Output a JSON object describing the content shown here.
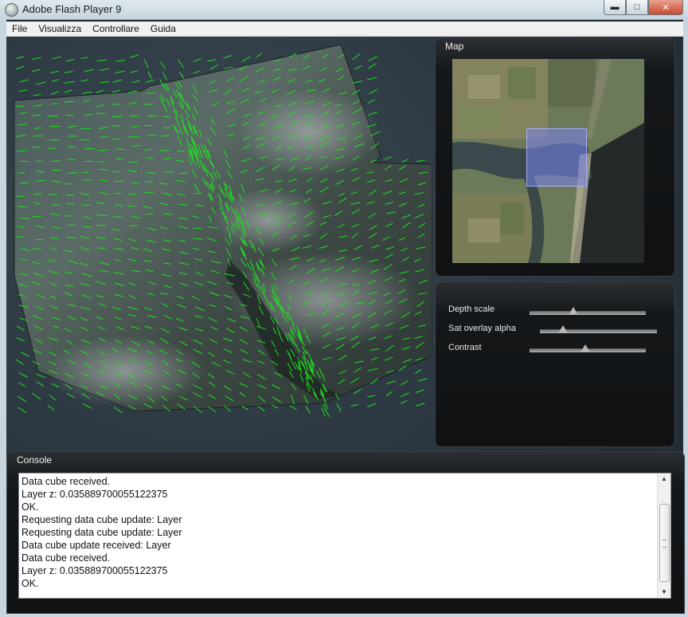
{
  "window": {
    "title": "Adobe Flash Player 9",
    "min_symbol": "▬",
    "max_symbol": "□",
    "close_symbol": "✕"
  },
  "menu": [
    "File",
    "Visualizza",
    "Controllare",
    "Guida"
  ],
  "map": {
    "title": "Map"
  },
  "controls": {
    "sliders": [
      {
        "label": "Depth scale",
        "value": 0.38
      },
      {
        "label": "Sat overlay alpha",
        "value": 0.2
      },
      {
        "label": "Contrast",
        "value": 0.48
      }
    ]
  },
  "console": {
    "title": "Console",
    "lines": [
      "Data cube received.",
      "Layer z: 0.035889700055122375",
      "OK.",
      "Requesting data cube update: Layer",
      "Requesting data cube update: Layer",
      "Data cube update received: Layer",
      "Data cube received.",
      "Layer z: 0.035889700055122375",
      "OK."
    ],
    "scroll_up": "▲",
    "scroll_down": "▼"
  },
  "colors": {
    "vector_color": "#19e619",
    "selection_color": "#8088ee",
    "panel_bg": "#15181a"
  },
  "icons": {
    "app": "flash-player-icon"
  }
}
